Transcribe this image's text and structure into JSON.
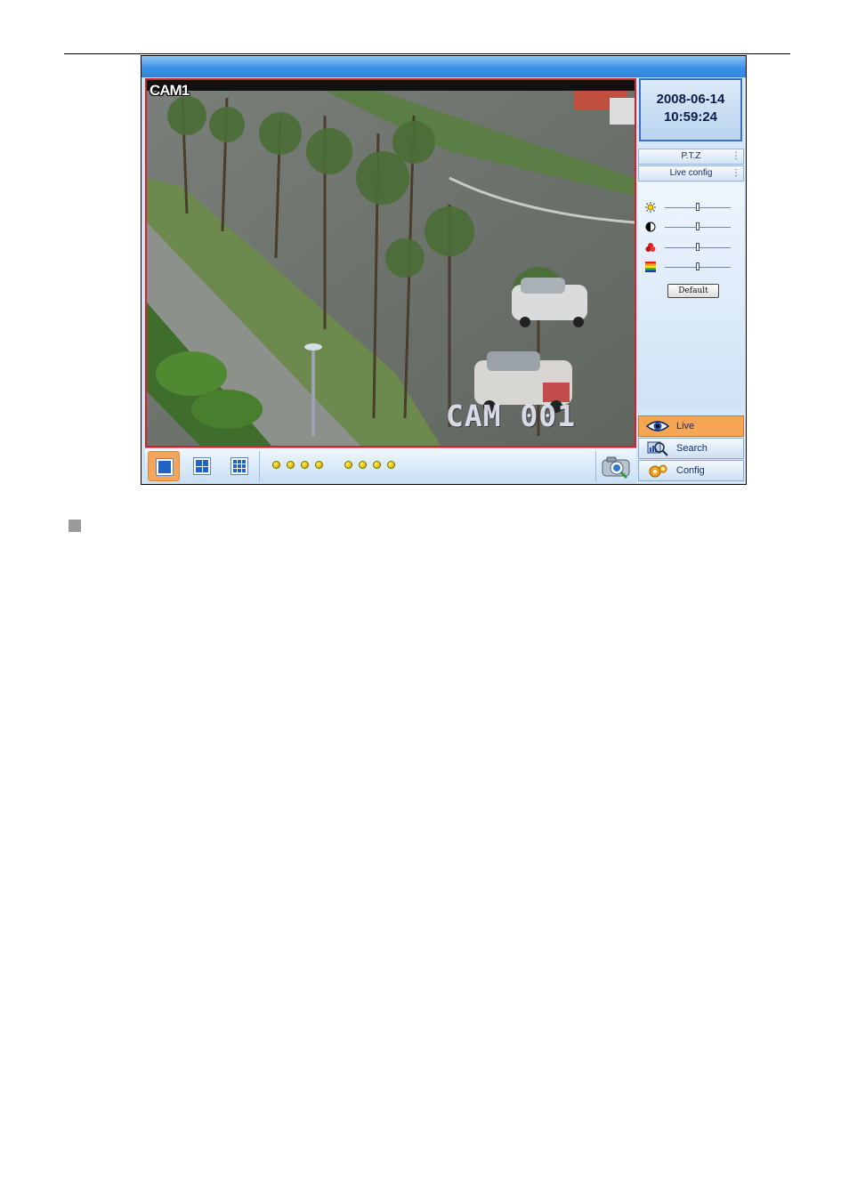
{
  "video": {
    "overlay_top": "CAM1",
    "overlay_bottom": "CAM 001"
  },
  "side_panel": {
    "date": "2008-06-14",
    "time": "10:59:24",
    "ptz_label": "P.T.Z",
    "live_config_label": "Live config",
    "more_glyph": "⋮",
    "sliders": [
      {
        "name": "brightness",
        "icon": "sun-icon",
        "level": 0.5
      },
      {
        "name": "contrast",
        "icon": "contrast-icon",
        "level": 0.5
      },
      {
        "name": "saturation",
        "icon": "color-balls-icon",
        "level": 0.5
      },
      {
        "name": "hue",
        "icon": "hue-bars-icon",
        "level": 0.5
      }
    ],
    "default_button": "Default"
  },
  "nav": {
    "live": "Live",
    "search": "Search",
    "config": "Config"
  },
  "bottom_bar": {
    "split_modes": [
      "single-view",
      "quad-view",
      "nine-view"
    ],
    "active_split": "single-view",
    "channel_dots": 8,
    "snapshot_icon": "camera-icon"
  },
  "colors": {
    "accent_orange": "#f6a553",
    "video_border": "#d8202a",
    "title_blue": "#3d92e8"
  }
}
